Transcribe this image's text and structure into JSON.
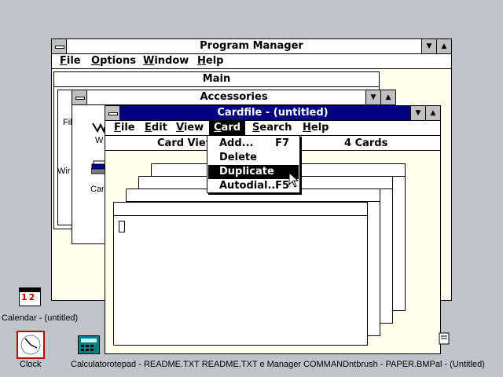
{
  "program_manager": {
    "title": "Program Manager",
    "menu": [
      "File",
      "Options",
      "Window",
      "Help"
    ],
    "group_main_title": "Main",
    "group_accessories_title": "Accessories",
    "partial_labels": [
      "Fil",
      "Wir",
      "W",
      "Car"
    ]
  },
  "cardfile": {
    "title": "Cardfile - (untitled)",
    "menu": [
      "File",
      "Edit",
      "View",
      "Card",
      "Search",
      "Help"
    ],
    "status_view": "Card View",
    "status_count": "4 Cards"
  },
  "card_menu": {
    "items": [
      {
        "label": "Add...",
        "accel": "F7"
      },
      {
        "label": "Delete",
        "accel": ""
      },
      {
        "label": "Duplicate",
        "accel": ""
      },
      {
        "label": "Autodial...",
        "accel": "F5"
      }
    ]
  },
  "desktop": {
    "calendar_label": "Calendar - (untitled)",
    "calendar_digits": "12",
    "taskbar_labels": "Calculatorotepad - README.TXT README.TXT e Manager",
    "clock_label": "Clock",
    "taskbar_labels_right": "COMMANDntbrush - PAPER.BMPal - (Untitled)"
  }
}
